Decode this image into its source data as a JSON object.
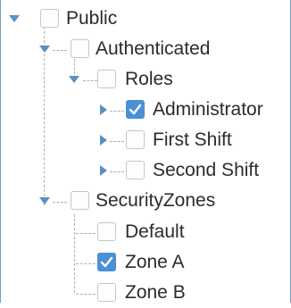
{
  "tree": {
    "nodes": [
      {
        "label": "Public",
        "checked": false,
        "expanded": true
      },
      {
        "label": "Authenticated",
        "checked": false,
        "expanded": true
      },
      {
        "label": "Roles",
        "checked": false,
        "expanded": true
      },
      {
        "label": "Administrator",
        "checked": true,
        "expanded": false
      },
      {
        "label": "First Shift",
        "checked": false,
        "expanded": false
      },
      {
        "label": "Second Shift",
        "checked": false,
        "expanded": false
      },
      {
        "label": "SecurityZones",
        "checked": false,
        "expanded": true
      },
      {
        "label": "Default",
        "checked": false
      },
      {
        "label": "Zone A",
        "checked": true
      },
      {
        "label": "Zone B",
        "checked": false
      }
    ]
  },
  "colors": {
    "accent": "#4a90d9",
    "border": "#6f9fca",
    "connector": "#b0b0b0"
  }
}
